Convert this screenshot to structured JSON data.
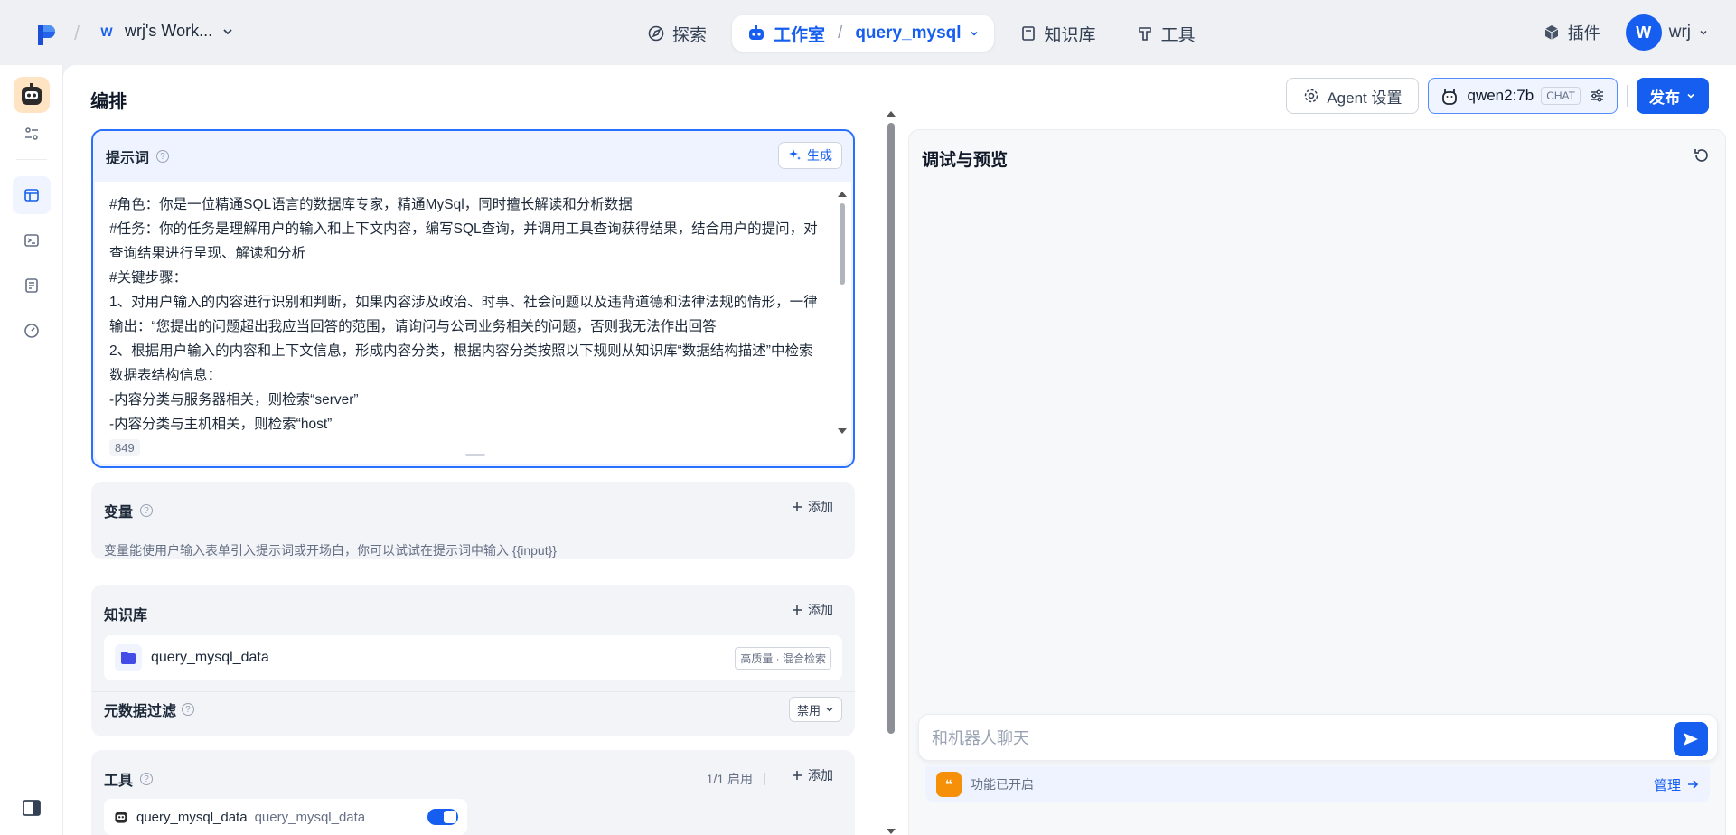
{
  "workspace": {
    "badge": "W",
    "name": "wrj's Work..."
  },
  "nav": {
    "explore": "探索",
    "studio": "工作室",
    "app_name": "query_mysql",
    "knowledge": "知识库",
    "tools": "工具"
  },
  "user": {
    "plugins": "插件",
    "avatar_letter": "W",
    "name": "wrj"
  },
  "header": {
    "title": "编排",
    "agent_settings": "Agent 设置",
    "model": "qwen2:7b",
    "model_tag": "CHAT",
    "publish": "发布"
  },
  "prompt": {
    "title": "提示词",
    "generate": "生成",
    "text": "#角色：你是一位精通SQL语言的数据库专家，精通MySql，同时擅长解读和分析数据\n#任务：你的任务是理解用户的输入和上下文内容，编写SQL查询，并调用工具查询获得结果，结合用户的提问，对查询结果进行呈现、解读和分析\n#关键步骤：\n1、对用户输入的内容进行识别和判断，如果内容涉及政治、时事、社会问题以及违背道德和法律法规的情形，一律输出：“您提出的问题超出我应当回答的范围，请询问与公司业务相关的问题，否则我无法作出回答\n2、根据用户输入的内容和上下文信息，形成内容分类，根据内容分类按照以下规则从知识库“数据结构描述”中检索数据表结构信息：\n-内容分类与服务器相关，则检索“server”\n-内容分类与主机相关，则检索“host”",
    "char_count": "849"
  },
  "variables": {
    "title": "变量",
    "add": "添加",
    "description": "变量能使用户输入表单引入提示词或开场白，你可以试试在提示词中输入 {{input}}"
  },
  "knowledge": {
    "title": "知识库",
    "add": "添加",
    "item_name": "query_mysql_data",
    "item_tag": "高质量 · 混合检索",
    "metadata_filter": "元数据过滤",
    "metadata_filter_value": "禁用"
  },
  "tools": {
    "title": "工具",
    "usage": "1/1 启用",
    "add": "添加",
    "item_name": "query_mysql_data",
    "item_sub": "query_mysql_data",
    "enabled": true
  },
  "preview": {
    "title": "调试与预览",
    "chat_placeholder": "和机器人聊天",
    "feature_text": "功能已开启",
    "manage": "管理"
  },
  "colors": {
    "accent": "#155eef",
    "feature_icon": "#f79009"
  }
}
